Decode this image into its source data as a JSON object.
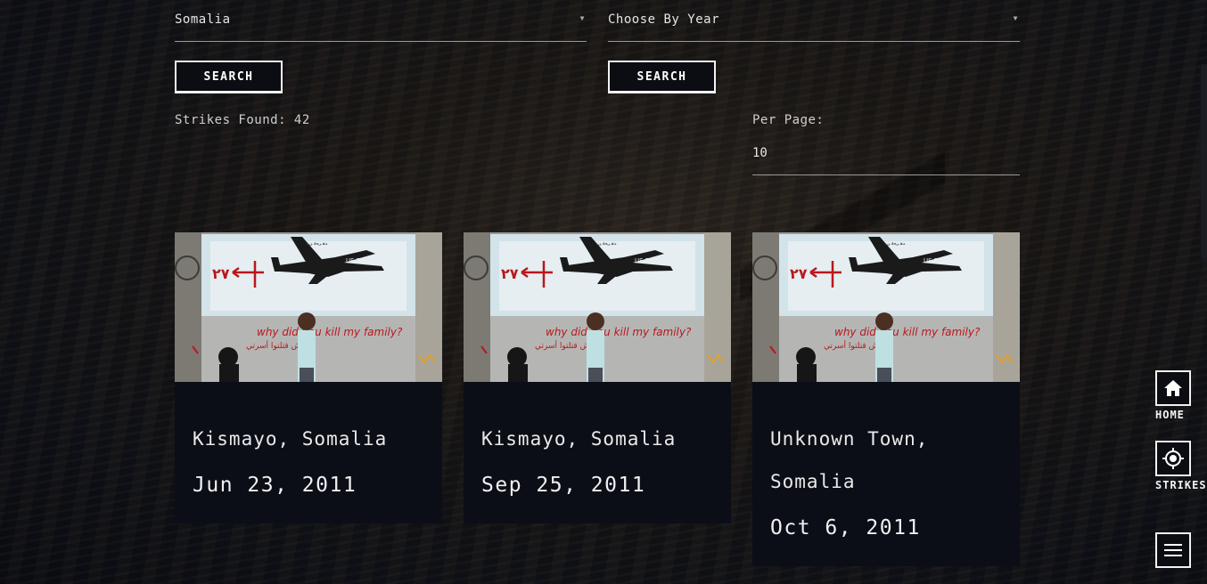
{
  "filters": {
    "country": "Somalia",
    "year_placeholder": "Choose By Year",
    "search_label_1": "SEARCH",
    "search_label_2": "SEARCH"
  },
  "results": {
    "strikes_found_label": "Strikes Found: 42",
    "per_page_label": "Per Page:",
    "per_page_value": "10"
  },
  "cards": [
    {
      "place": "Kismayo, Somalia",
      "date": "Jun 23, 2011"
    },
    {
      "place": "Kismayo, Somalia",
      "date": "Sep 25, 2011"
    },
    {
      "place_line1": "Unknown Town,",
      "place_line2": "Somalia",
      "date": "Oct 6, 2011"
    }
  ],
  "mural": {
    "slogan": "why did you kill my family?",
    "plane_tag": "US Drones",
    "count_text": "٢٧"
  },
  "side_nav": {
    "home": "HOME",
    "strikes": "STRIKES",
    "menu_icon": "hamburger-icon",
    "home_icon": "home-icon",
    "strikes_icon": "target-icon"
  },
  "colors": {
    "card_bg": "#0b0e16",
    "accent_red": "#b8181d",
    "border": "#f2f2f2"
  }
}
